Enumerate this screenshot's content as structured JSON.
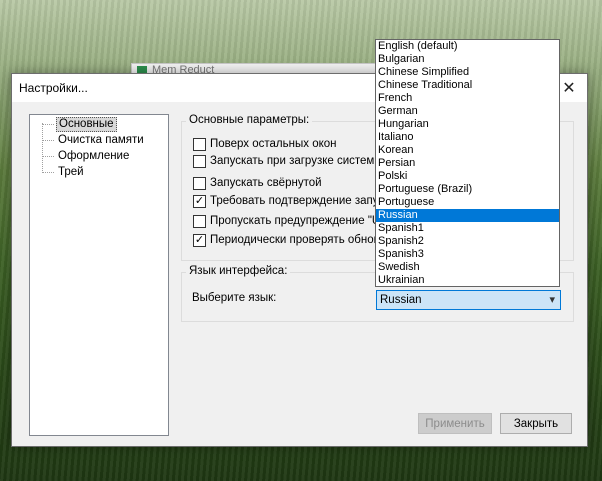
{
  "background_window": {
    "title": "Mem Reduct"
  },
  "dialog": {
    "title": "Настройки...",
    "close_glyph": "✕",
    "tree": [
      {
        "label": "Основные",
        "selected": true
      },
      {
        "label": "Очистка памяти"
      },
      {
        "label": "Оформление"
      },
      {
        "label": "Трей"
      }
    ],
    "main_group": {
      "label": "Основные параметры:",
      "options": [
        {
          "label": "Поверх остальных окон",
          "checked": false
        },
        {
          "label": "Запускать при загрузке системы",
          "checked": false
        },
        {
          "label": "Запускать свёрнутой",
          "checked": false
        },
        {
          "label": "Требовать подтверждение запус",
          "checked": true
        },
        {
          "label": "Пропускать предупреждение \"Us",
          "checked": false
        },
        {
          "label": "Периодически проверять обновл",
          "checked": true
        }
      ]
    },
    "language_group": {
      "label": "Язык интерфейса:",
      "select_label": "Выберите язык:",
      "selected": "Russian"
    },
    "buttons": {
      "apply": "Применить",
      "close": "Закрыть"
    }
  },
  "dropdown": {
    "items": [
      "English (default)",
      "Bulgarian",
      "Chinese Simplified",
      "Chinese Traditional",
      "French",
      "German",
      "Hungarian",
      "Italiano",
      "Korean",
      "Persian",
      "Polski",
      "Portuguese (Brazil)",
      "Portuguese",
      "Russian",
      "Spanish1",
      "Spanish2",
      "Spanish3",
      "Swedish",
      "Ukrainian"
    ],
    "highlighted": "Russian"
  },
  "colors": {
    "accent": "#0078d7",
    "combo_bg": "#cce4f7"
  },
  "icons": {
    "close": "close-icon",
    "dropdown_arrow": "chevron-down-icon",
    "check": "checkmark-icon"
  }
}
